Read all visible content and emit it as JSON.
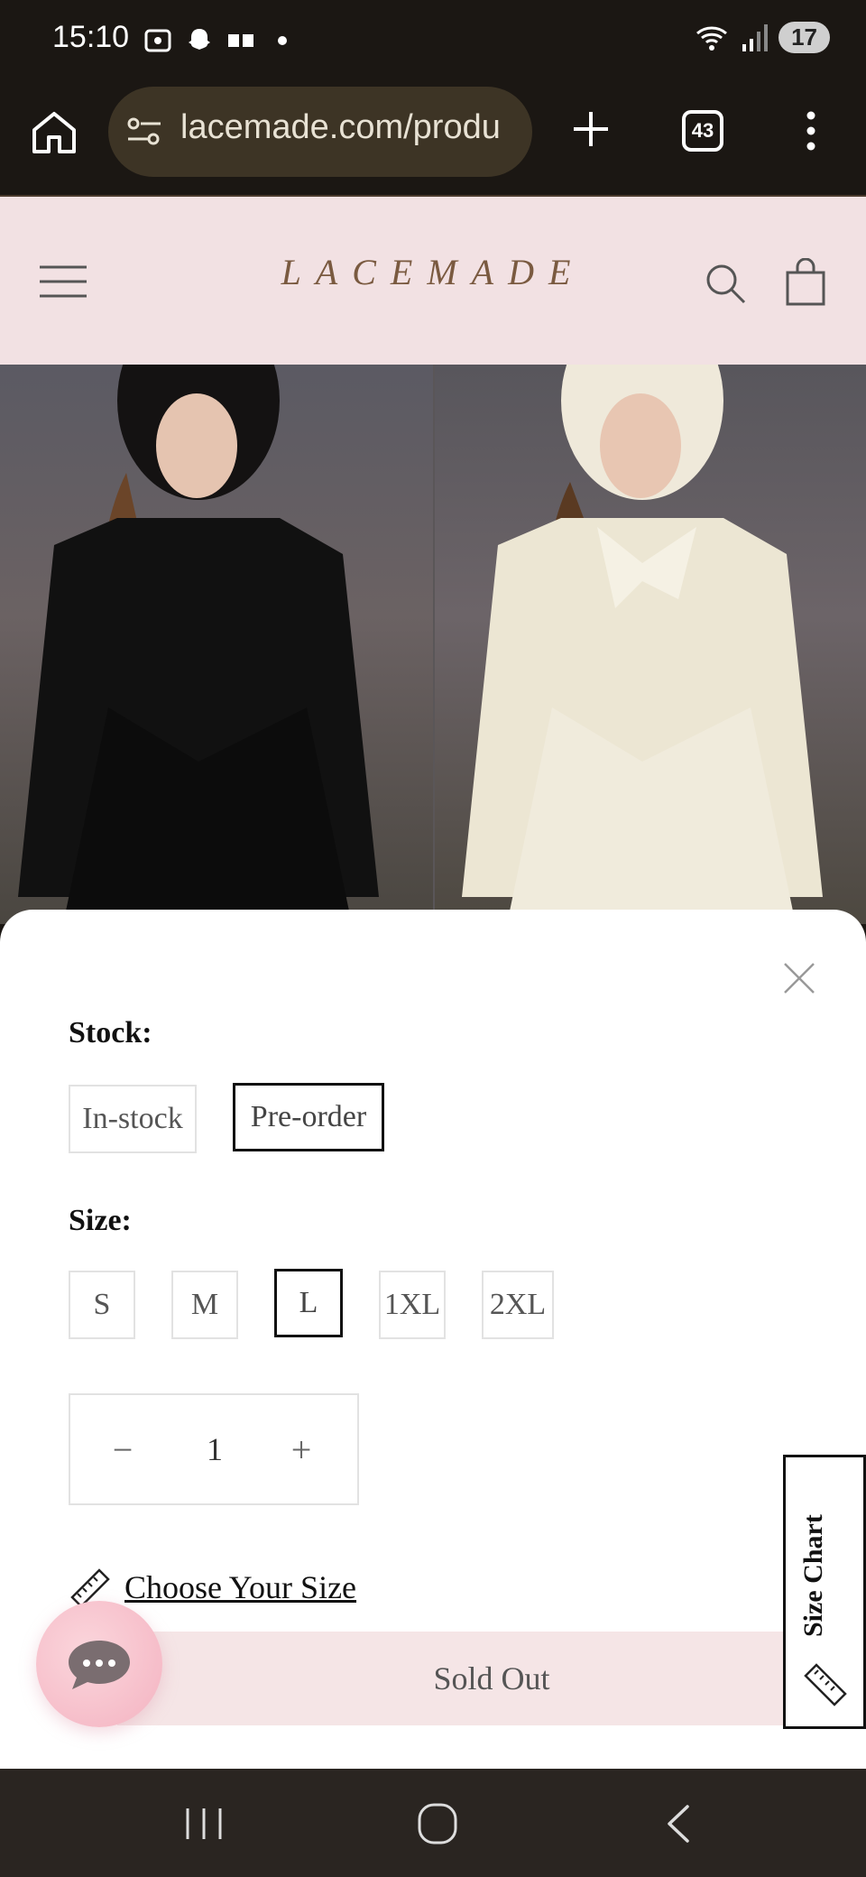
{
  "status_bar": {
    "time": "15:10",
    "battery": "17"
  },
  "browser": {
    "url": "lacemade.com/produ",
    "tab_count": "43"
  },
  "site": {
    "logo": "LACEMADE"
  },
  "sheet": {
    "stock_label": "Stock:",
    "stock_options": [
      "In-stock",
      "Pre-order"
    ],
    "stock_selected": "Pre-order",
    "size_label": "Size:",
    "size_options": [
      "S",
      "M",
      "L",
      "1XL",
      "2XL"
    ],
    "size_selected": "L",
    "quantity": "1",
    "quantity_minus": "−",
    "quantity_plus": "+",
    "choose_size": "Choose Your Size",
    "sold_out": "Sold Out",
    "size_chart": "Size Chart"
  },
  "colors": {
    "header_bg": "#f2e1e3",
    "soldout_bg": "#f5e5e6",
    "chat_bg": "#f6bdc9",
    "browser_bg": "#1b1713",
    "url_bg": "#3d3425"
  },
  "icons": {
    "home": "home-icon",
    "site_settings": "site-settings-icon",
    "new_tab": "plus-icon",
    "overflow": "more-vertical-icon",
    "hamburger": "menu-icon",
    "search": "search-icon",
    "cart": "shopping-bag-icon",
    "close": "close-icon",
    "ruler": "ruler-icon",
    "chat": "chat-icon"
  }
}
